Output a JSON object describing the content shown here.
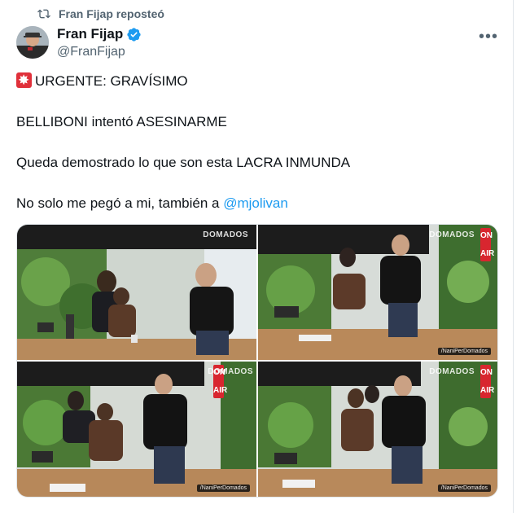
{
  "repost": {
    "text": "Fran Fijap reposteó"
  },
  "author": {
    "name": "Fran Fijap",
    "handle": "@FranFijap",
    "verified_color": "#1d9bf0"
  },
  "tweet": {
    "line1": "URGENTE: GRAVÍSIMO",
    "line2": "BELLIBONI intentó ASESINARME",
    "line3": "Queda demostrado lo que son esta LACRA INMUNDA",
    "line4_prefix": "No solo me pegó a mi, también a ",
    "mention": "@mjolivan"
  },
  "media": {
    "watermark": "DOMADOS",
    "onair_top": "ON",
    "onair_bottom": "AIR",
    "tag": "/NaniPerDomados"
  },
  "icons": {
    "repost": "repost-icon",
    "verified": "verified-badge-icon",
    "more": "more-options-icon",
    "siren": "siren-emoji-icon"
  },
  "colors": {
    "link": "#1d9bf0",
    "secondary": "#536471",
    "onair": "#d8262f"
  }
}
